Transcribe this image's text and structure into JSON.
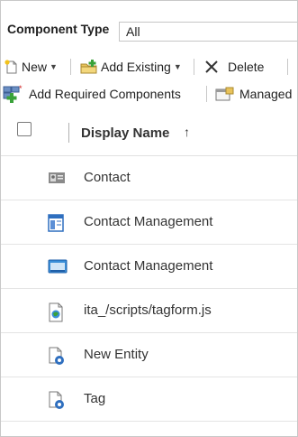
{
  "filter": {
    "label": "Component Type",
    "value": "All"
  },
  "toolbar": {
    "new_label": "New",
    "add_existing_label": "Add Existing",
    "delete_label": "Delete",
    "add_required_label": "Add Required Components",
    "managed_label": "Managed"
  },
  "grid": {
    "column_header": "Display Name",
    "sort_glyph": "↑",
    "rows": [
      {
        "label": "Contact",
        "icon": "contact-card-icon"
      },
      {
        "label": "Contact Management",
        "icon": "form-icon"
      },
      {
        "label": "Contact Management",
        "icon": "view-icon"
      },
      {
        "label": "ita_/scripts/tagform.js",
        "icon": "script-file-icon"
      },
      {
        "label": "New Entity",
        "icon": "entity-gear-icon"
      },
      {
        "label": "Tag",
        "icon": "entity-gear-icon"
      }
    ]
  },
  "colors": {
    "icon_blue": "#2f6fbf",
    "icon_gray": "#6b6b6b",
    "add_green": "#3aa23a",
    "delete_dark": "#333333"
  }
}
